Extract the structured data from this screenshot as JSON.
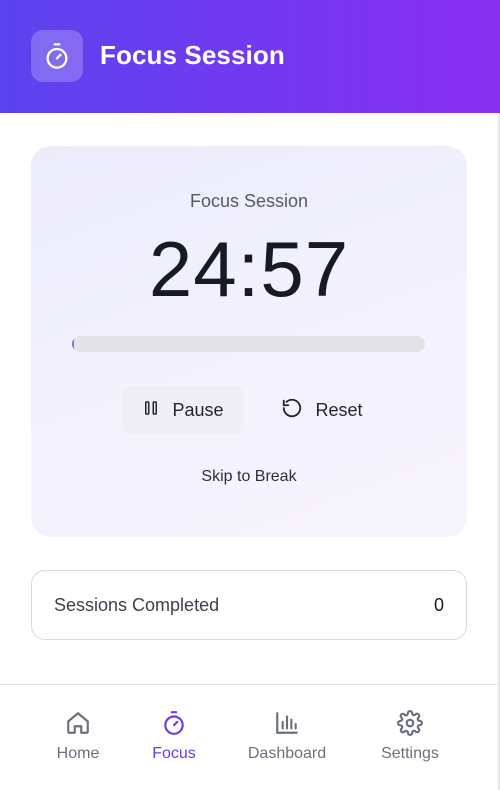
{
  "header": {
    "title": "Focus Session",
    "icon": "stopwatch-icon"
  },
  "timer": {
    "session_label": "Focus Session",
    "display": "24:57",
    "progress_fraction": 0.002,
    "pause_label": "Pause",
    "reset_label": "Reset",
    "skip_label": "Skip to Break"
  },
  "sessions": {
    "label": "Sessions Completed",
    "count": "0"
  },
  "nav": {
    "items": [
      {
        "label": "Home",
        "icon": "home-icon",
        "active": false
      },
      {
        "label": "Focus",
        "icon": "stopwatch-icon",
        "active": true
      },
      {
        "label": "Dashboard",
        "icon": "bar-chart-icon",
        "active": false
      },
      {
        "label": "Settings",
        "icon": "gear-icon",
        "active": false
      }
    ]
  },
  "colors": {
    "header_gradient_start": "#5b43ee",
    "header_gradient_end": "#8a2fef",
    "accent": "#6d3ae9",
    "progress_fill": "#7c6cf0"
  }
}
